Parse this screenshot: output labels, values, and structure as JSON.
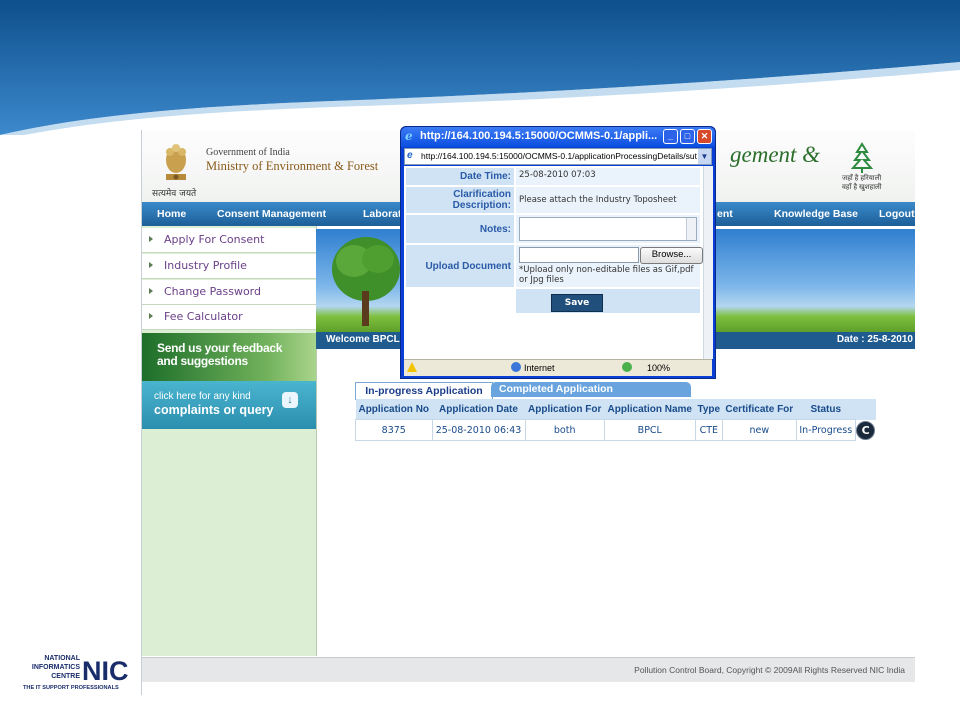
{
  "header": {
    "satyamev": "सत्यमेव जयते",
    "government": "Government of India",
    "ministry": "Ministry of Environment & Forest",
    "title_fragment": "gement &",
    "hindi_motto_1": "जहाँ है हरियाली",
    "hindi_motto_2": "वहाँ है खुशहाली"
  },
  "nav": {
    "items": [
      "Home",
      "Consent Management",
      "Laborato",
      "ent",
      "Knowledge Base",
      "Logout"
    ]
  },
  "sidebar": {
    "items": [
      "Apply For Consent",
      "Industry Profile",
      "Change Password",
      "Fee Calculator"
    ],
    "feedback_line1": "Send us your feedback",
    "feedback_line2": "and suggestions",
    "complaints_line1": "click here for any kind",
    "complaints_line2": "complaints or query"
  },
  "welcome": {
    "text": "Welcome BPCL",
    "date": "Date : 25-8-2010"
  },
  "tabs": {
    "active": "In-progress Application",
    "inactive": "Completed Application"
  },
  "table": {
    "headers": [
      "Application No",
      "Application Date",
      "Application For",
      "Application Name",
      "Type",
      "Certificate For",
      "Status"
    ],
    "rows": [
      {
        "app_no": "8375",
        "app_date": "25-08-2010 06:43",
        "app_for": "both",
        "app_name": "BPCL",
        "type": "CTE",
        "certificate_for": "new",
        "status": "In-Progress",
        "action_icon": "C"
      }
    ]
  },
  "footer": {
    "text": "Pollution Control Board, Copyright © 2009All Rights Reserved NIC India"
  },
  "nic_logo": {
    "line1": "NATIONAL",
    "line2": "INFORMATICS",
    "line3": "CENTRE",
    "tagline": "THE IT SUPPORT PROFESSIONALS",
    "mark": "NIC"
  },
  "popup": {
    "window_title": "http://164.100.194.5:15000/OCMMS-0.1/appli...",
    "address": "http://164.100.194.5:15000/OCMMS-0.1/applicationProcessingDetails/sut",
    "labels": {
      "date_time": "Date Time:",
      "clarification": "Clarification Description:",
      "notes": "Notes:",
      "upload": "Upload Document"
    },
    "values": {
      "date_time": "25-08-2010 07:03",
      "clarification": "Please attach the Industry Toposheet",
      "notes": "",
      "upload_hint": "*Upload only non-editable files as Gif,pdf or Jpg files"
    },
    "browse_label": "Browse...",
    "save_label": "Save",
    "status_zone": "Internet",
    "zoom": "100%"
  },
  "colors": {
    "nav_blue": "#2a73b5",
    "popup_frame": "#0a3fd6",
    "label_bg": "#cfe3f4",
    "link_purple": "#6b3f88"
  }
}
